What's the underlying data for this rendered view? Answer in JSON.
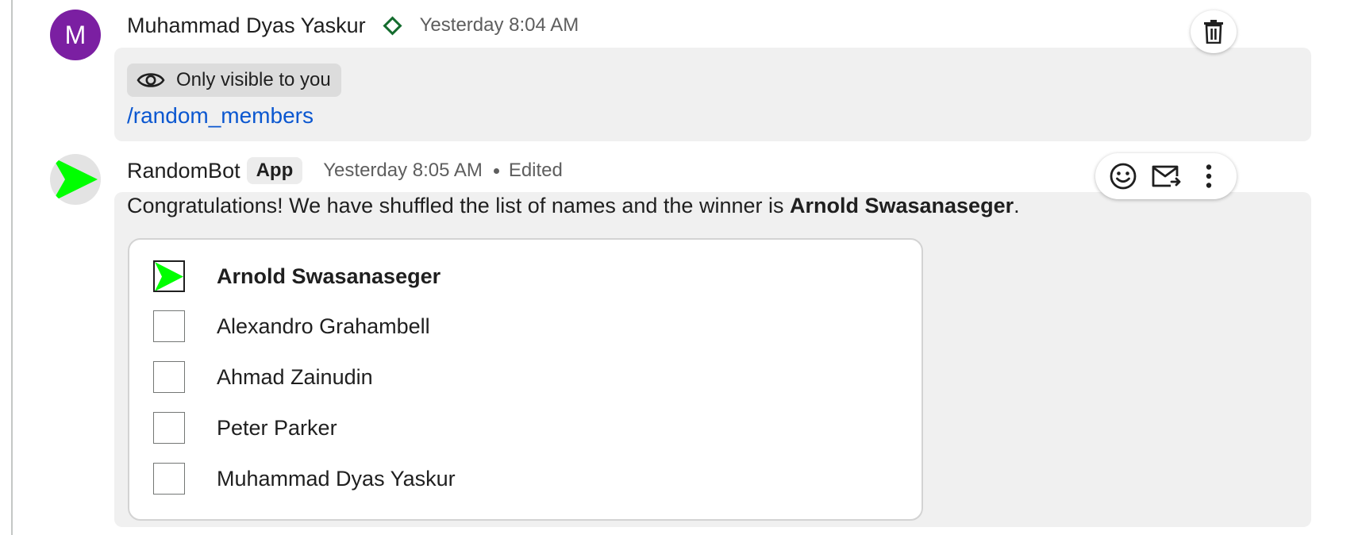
{
  "messages": [
    {
      "sender": "Muhammad Dyas Yaskur",
      "avatar_letter": "M",
      "avatar_color": "#7b1fa2",
      "status_icon": "diamond-icon",
      "timestamp": "Yesterday 8:04 AM",
      "visibility_label": "Only visible to you",
      "command": "/random_members",
      "hover_action": "delete-icon"
    },
    {
      "sender": "RandomBot",
      "badge": "App",
      "timestamp": "Yesterday 8:05 AM",
      "edited_label": "Edited",
      "avatar_icon": "green-arrow-icon",
      "text_before": "Congratulations! We have shuffled the list of names and the winner is ",
      "winner": "Arnold Swasanaseger",
      "text_after": ".",
      "hover_actions": [
        "add-reaction-icon",
        "forward-to-inbox-icon",
        "more-options-icon"
      ],
      "list": [
        {
          "name": "Arnold Swasanaseger",
          "winner": true
        },
        {
          "name": "Alexandro Grahambell",
          "winner": false
        },
        {
          "name": "Ahmad Zainudin",
          "winner": false
        },
        {
          "name": "Peter Parker",
          "winner": false
        },
        {
          "name": "Muhammad Dyas Yaskur",
          "winner": false
        }
      ]
    }
  ],
  "colors": {
    "link": "#0b57d0",
    "bot_arrow": "#00ff00",
    "verified_diamond": "#146c2e",
    "bubble_bg": "#f0f0f0"
  }
}
